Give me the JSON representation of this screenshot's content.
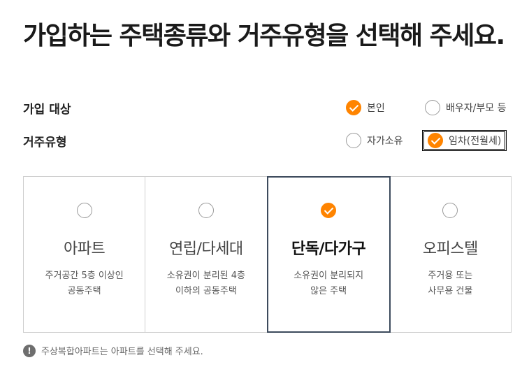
{
  "title": "가입하는 주택종류와 거주유형을 선택해 주세요.",
  "enrollee": {
    "label": "가입 대상",
    "options": [
      {
        "label": "본인",
        "checked": true
      },
      {
        "label": "배우자/부모 등",
        "checked": false
      }
    ]
  },
  "residence": {
    "label": "거주유형",
    "options": [
      {
        "label": "자가소유",
        "checked": false
      },
      {
        "label": "임차(전월세)",
        "checked": true
      }
    ]
  },
  "housing_types": [
    {
      "title": "아파트",
      "desc": "주거공간 5층 이상인\n공동주택",
      "selected": false
    },
    {
      "title": "연립/다세대",
      "desc": "소유권이 분리된 4층\n이하의 공동주택",
      "selected": false
    },
    {
      "title": "단독/다가구",
      "desc": "소유권이 분리되지\n않은 주택",
      "selected": true
    },
    {
      "title": "오피스텔",
      "desc": "주거용 또는\n사무용 건물",
      "selected": false
    }
  ],
  "notice": {
    "icon": "info-icon",
    "glyph": "!",
    "text": "주상복합아파트는 아파트를 선택해 주세요."
  },
  "colors": {
    "accent": "#ff8400",
    "selected_border": "#3c4a5c"
  }
}
